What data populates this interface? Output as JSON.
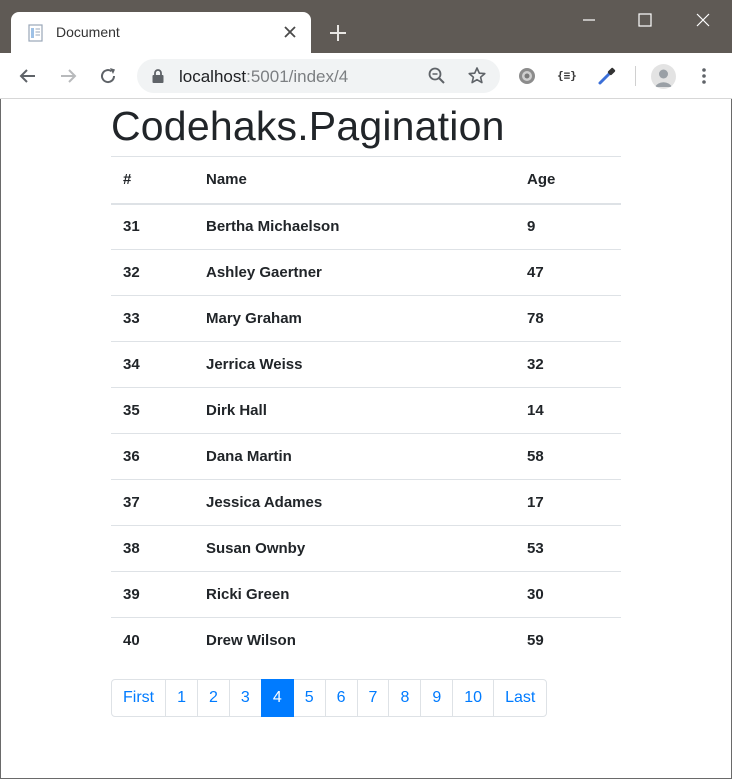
{
  "browser": {
    "tab_title": "Document",
    "url_host": "localhost",
    "url_path": ":5001/index/4",
    "extension_label": "{≡}"
  },
  "page": {
    "title": "Codehaks.Pagination"
  },
  "table": {
    "headers": [
      "#",
      "Name",
      "Age"
    ],
    "rows": [
      {
        "id": "31",
        "name": "Bertha Michaelson",
        "age": "9"
      },
      {
        "id": "32",
        "name": "Ashley Gaertner",
        "age": "47"
      },
      {
        "id": "33",
        "name": "Mary Graham",
        "age": "78"
      },
      {
        "id": "34",
        "name": "Jerrica Weiss",
        "age": "32"
      },
      {
        "id": "35",
        "name": "Dirk Hall",
        "age": "14"
      },
      {
        "id": "36",
        "name": "Dana Martin",
        "age": "58"
      },
      {
        "id": "37",
        "name": "Jessica Adames",
        "age": "17"
      },
      {
        "id": "38",
        "name": "Susan Ownby",
        "age": "53"
      },
      {
        "id": "39",
        "name": "Ricki Green",
        "age": "30"
      },
      {
        "id": "40",
        "name": "Drew Wilson",
        "age": "59"
      }
    ]
  },
  "pagination": {
    "first_label": "First",
    "pages": [
      "1",
      "2",
      "3",
      "4",
      "5",
      "6",
      "7",
      "8",
      "9",
      "10"
    ],
    "active_page": "4",
    "last_label": "Last"
  },
  "colors": {
    "titlebar": "#5f5a55",
    "link": "#007bff",
    "active_page_bg": "#007bff",
    "text": "#212529",
    "border": "#dee2e6"
  }
}
